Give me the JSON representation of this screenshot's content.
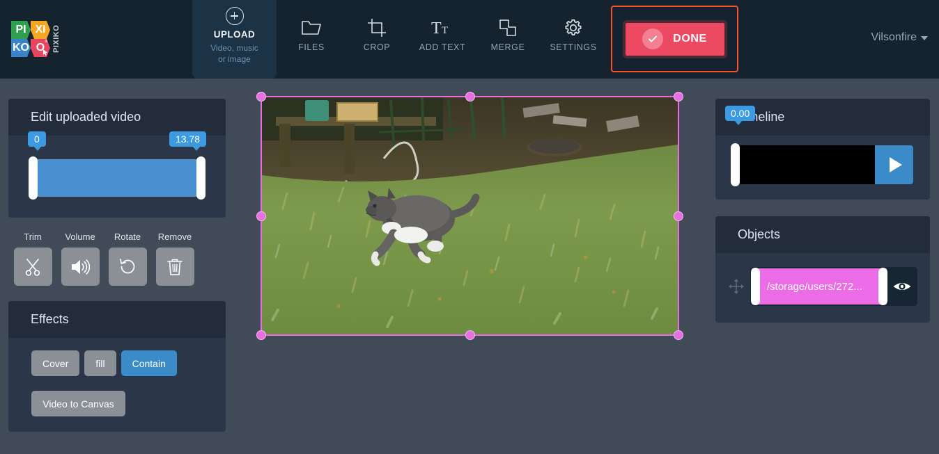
{
  "header": {
    "logo": {
      "cells": [
        "PI",
        "XI",
        "KO",
        "O"
      ],
      "vertical_text": "PIXIKO",
      "reg_mark": "®",
      "colors": {
        "green": "#2e9e4f",
        "orange": "#f5a623",
        "blue": "#3b83c9",
        "red": "#e8455f"
      }
    },
    "upload": {
      "icon": "plus-circle-icon",
      "title": "UPLOAD",
      "subtitle": "Video, music\nor image",
      "subtitle_line1": "Video, music",
      "subtitle_line2": "or image"
    },
    "toolbar": [
      {
        "label": "FILES",
        "icon": "folder-icon"
      },
      {
        "label": "CROP",
        "icon": "crop-icon"
      },
      {
        "label": "ADD TEXT",
        "icon": "text-icon"
      },
      {
        "label": "MERGE",
        "icon": "merge-icon"
      },
      {
        "label": "SETTINGS",
        "icon": "gear-icon"
      }
    ],
    "done_button": {
      "label": "DONE",
      "icon": "check-circle-icon",
      "color": "#ec4a63",
      "highlight_color": "#f4512c"
    },
    "user": {
      "name": "Vilsonfire",
      "caret": "chevron-down-icon"
    }
  },
  "edit_panel": {
    "title": "Edit uploaded video",
    "trim_range": {
      "start_label": "0",
      "end_label": "13.78",
      "start_value": 0,
      "end_value": 13.78,
      "track_color": "#4a90d0",
      "bubble_color": "#3b9ae1"
    },
    "actions": [
      {
        "label": "Trim",
        "icon": "scissors-icon"
      },
      {
        "label": "Volume",
        "icon": "speaker-icon"
      },
      {
        "label": "Rotate",
        "icon": "rotate-ccw-icon"
      },
      {
        "label": "Remove",
        "icon": "trash-icon"
      }
    ]
  },
  "effects_panel": {
    "title": "Effects",
    "fit_options": [
      {
        "label": "Cover",
        "active": false
      },
      {
        "label": "fill",
        "active": false
      },
      {
        "label": "Contain",
        "active": true
      }
    ],
    "video_to_canvas_label": "Video to Canvas",
    "active_color": "#3b8bc9"
  },
  "preview": {
    "name": "video-preview-canvas",
    "description": "Gray and white cat walking across a green lawn in a backyard",
    "selection_color": "#e86fe2",
    "handles": 8
  },
  "timeline_panel": {
    "title": "Timeline",
    "playhead_label": "0.00",
    "playhead_value": 0.0,
    "play_icon": "play-icon",
    "track_color": "#000000",
    "play_button_color": "#3b8bc9"
  },
  "objects_panel": {
    "title": "Objects",
    "move_icon": "move-arrows-icon",
    "items": [
      {
        "name": "/storage/users/272...",
        "color": "#ec6ce8",
        "visibility_icon": "eye-icon"
      }
    ]
  }
}
